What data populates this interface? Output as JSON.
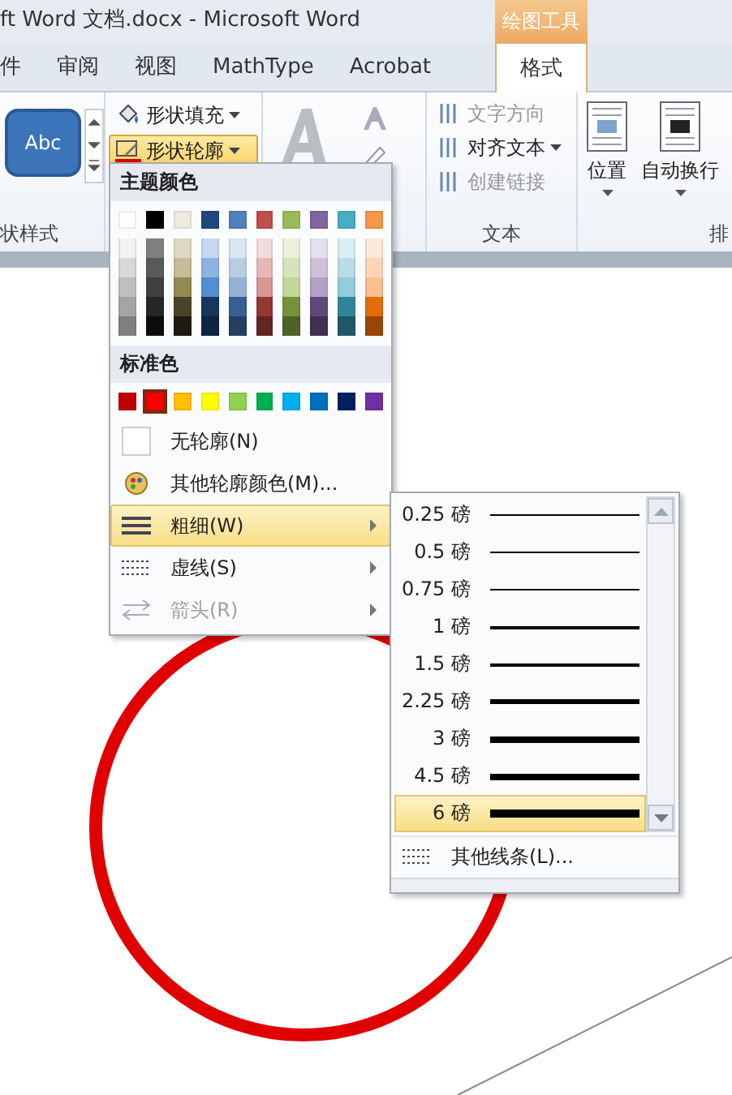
{
  "window": {
    "title": "ft Word 文档.docx  -  Microsoft Word",
    "context_tab_group": "绘图工具"
  },
  "tabs": [
    {
      "label": "件",
      "selected": false
    },
    {
      "label": "审阅",
      "selected": false
    },
    {
      "label": "视图",
      "selected": false
    },
    {
      "label": "MathType",
      "selected": false
    },
    {
      "label": "Acrobat",
      "selected": false
    },
    {
      "label": "格式",
      "selected": true
    }
  ],
  "ribbon": {
    "shape_styles": {
      "sample": "Abc",
      "label": "状样式"
    },
    "shape_fill": {
      "label": "形状填充",
      "pressed": false
    },
    "shape_outline": {
      "label": "形状轮廓",
      "pressed": true
    },
    "text_group": {
      "label": "文本",
      "items": [
        {
          "label": "文字方向",
          "disabled": true
        },
        {
          "label": "对齐文本",
          "disabled": false
        },
        {
          "label": "创建链接",
          "disabled": true
        }
      ]
    },
    "arrange": {
      "label": "排",
      "items": [
        {
          "label": "位置"
        },
        {
          "label": "自动换行"
        }
      ]
    }
  },
  "outline_menu": {
    "theme_header": "主题颜色",
    "theme_top": [
      {
        "color": "#ffffff"
      },
      {
        "color": "#000000"
      },
      {
        "color": "#eeece1"
      },
      {
        "color": "#1f497d"
      },
      {
        "color": "#4f81bd"
      },
      {
        "color": "#c0504d"
      },
      {
        "color": "#9bbb59"
      },
      {
        "color": "#8064a2"
      },
      {
        "color": "#4bacc6"
      },
      {
        "color": "#f79646"
      }
    ],
    "theme_shades": [
      [
        {
          "color": "#f2f2f2"
        },
        {
          "color": "#7f7f7f"
        },
        {
          "color": "#ddd9c3"
        },
        {
          "color": "#c6d9f0"
        },
        {
          "color": "#dbe5f1"
        },
        {
          "color": "#f2dcdb"
        },
        {
          "color": "#ebf1dd"
        },
        {
          "color": "#e5e0ec"
        },
        {
          "color": "#dbeef3"
        },
        {
          "color": "#fdeada"
        }
      ],
      [
        {
          "color": "#d8d8d8"
        },
        {
          "color": "#595959"
        },
        {
          "color": "#c4bd97"
        },
        {
          "color": "#8db3e2"
        },
        {
          "color": "#b8cce4"
        },
        {
          "color": "#e5b9b7"
        },
        {
          "color": "#d7e3bc"
        },
        {
          "color": "#ccc1d9"
        },
        {
          "color": "#b7dde8"
        },
        {
          "color": "#fbd5b5"
        }
      ],
      [
        {
          "color": "#bfbfbf"
        },
        {
          "color": "#3f3f3f"
        },
        {
          "color": "#938953"
        },
        {
          "color": "#548dd4"
        },
        {
          "color": "#95b3d7"
        },
        {
          "color": "#d99694"
        },
        {
          "color": "#c3d69b"
        },
        {
          "color": "#b2a2c7"
        },
        {
          "color": "#92cddc"
        },
        {
          "color": "#fac08f"
        }
      ],
      [
        {
          "color": "#a5a5a5"
        },
        {
          "color": "#262626"
        },
        {
          "color": "#494429"
        },
        {
          "color": "#17365d"
        },
        {
          "color": "#366092"
        },
        {
          "color": "#953734"
        },
        {
          "color": "#76923c"
        },
        {
          "color": "#5f497a"
        },
        {
          "color": "#31859b"
        },
        {
          "color": "#e36c09"
        }
      ],
      [
        {
          "color": "#7f7f7f"
        },
        {
          "color": "#0c0c0c"
        },
        {
          "color": "#1d1b10"
        },
        {
          "color": "#0f243e"
        },
        {
          "color": "#244061"
        },
        {
          "color": "#632423"
        },
        {
          "color": "#4f6128"
        },
        {
          "color": "#3f3151"
        },
        {
          "color": "#205867"
        },
        {
          "color": "#974806"
        }
      ]
    ],
    "standard_header": "标准色",
    "standard_colors": [
      {
        "color": "#c00000",
        "selected": false
      },
      {
        "color": "#ff0000",
        "selected": true
      },
      {
        "color": "#ffc000",
        "selected": false
      },
      {
        "color": "#ffff00",
        "selected": false
      },
      {
        "color": "#92d050",
        "selected": false
      },
      {
        "color": "#00b050",
        "selected": false
      },
      {
        "color": "#00b0f0",
        "selected": false
      },
      {
        "color": "#0070c0",
        "selected": false
      },
      {
        "color": "#002060",
        "selected": false
      },
      {
        "color": "#7030a0",
        "selected": false
      }
    ],
    "items": [
      {
        "kind": "no_outline",
        "label": "无轮廓(N)",
        "selected": false,
        "disabled": false,
        "submenu": false
      },
      {
        "kind": "more_colors",
        "label": "其他轮廓颜色(M)...",
        "selected": false,
        "disabled": false,
        "submenu": false
      },
      {
        "kind": "weight",
        "label": "粗细(W)",
        "selected": true,
        "disabled": false,
        "submenu": true
      },
      {
        "kind": "dashes",
        "label": "虚线(S)",
        "selected": false,
        "disabled": false,
        "submenu": true
      },
      {
        "kind": "arrows",
        "label": "箭头(R)",
        "selected": false,
        "disabled": true,
        "submenu": true
      }
    ]
  },
  "weight_menu": {
    "items": [
      {
        "label": "0.25 磅",
        "selected": false
      },
      {
        "label": "0.5 磅",
        "selected": false
      },
      {
        "label": "0.75 磅",
        "selected": false
      },
      {
        "label": "1 磅",
        "selected": false
      },
      {
        "label": "1.5 磅",
        "selected": false
      },
      {
        "label": "2.25 磅",
        "selected": false
      },
      {
        "label": "3 磅",
        "selected": false
      },
      {
        "label": "4.5 磅",
        "selected": false
      },
      {
        "label": "6 磅",
        "selected": true
      }
    ],
    "more": "其他线条(L)..."
  }
}
